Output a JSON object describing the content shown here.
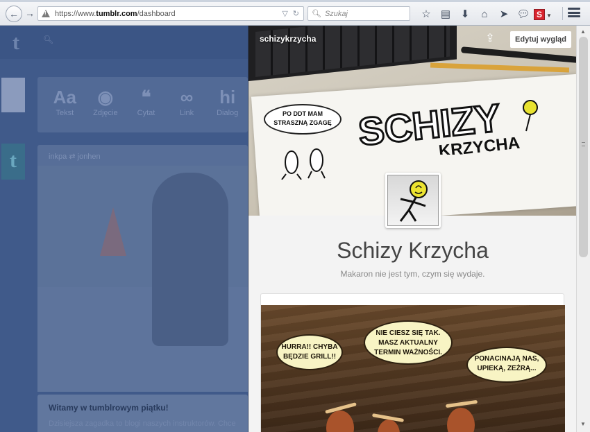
{
  "browser": {
    "url_prefix": "https://www.",
    "url_domain": "tumblr.com",
    "url_path": "/dashboard",
    "search_placeholder": "Szukaj",
    "s_icon_letter": "S"
  },
  "dashboard": {
    "logo": "t",
    "post_types": [
      {
        "glyph": "Aa",
        "label": "Tekst"
      },
      {
        "glyph": "◉",
        "label": "Zdjęcie"
      },
      {
        "glyph": "❝",
        "label": "Cytat"
      },
      {
        "glyph": "∞",
        "label": "Link"
      },
      {
        "glyph": "hi",
        "label": "Dialog"
      }
    ],
    "post_meta": "inkpa ⇄ jonhen",
    "welcome_title": "Witamy w tumblrowym piątku!",
    "welcome_sub": "Dzisiejsza zagadka to blogi naszych instruktorów. Chce",
    "avatar2_letter": "t"
  },
  "panel": {
    "blog_name": "schizykrzycha",
    "edit_button": "Edytuj wygląd",
    "header_bubble": "PO DDT MAM STRASZNĄ ZGAGĘ",
    "logo_top": "SCHIZY",
    "logo_bottom": "KRZYCHA",
    "title": "Schizy Krzycha",
    "description": "Makaron nie jest tym, czym się wydaje.",
    "comic_bubbles": [
      "HURRA!! CHYBA BĘDZIE GRILL!!",
      "NIE CIESZ SIĘ TAK. MASZ AKTUALNY TERMIN WAŻNOŚCI.",
      "PONACINAJĄ NAS, UPIEKĄ, ZEŻRĄ..."
    ]
  }
}
